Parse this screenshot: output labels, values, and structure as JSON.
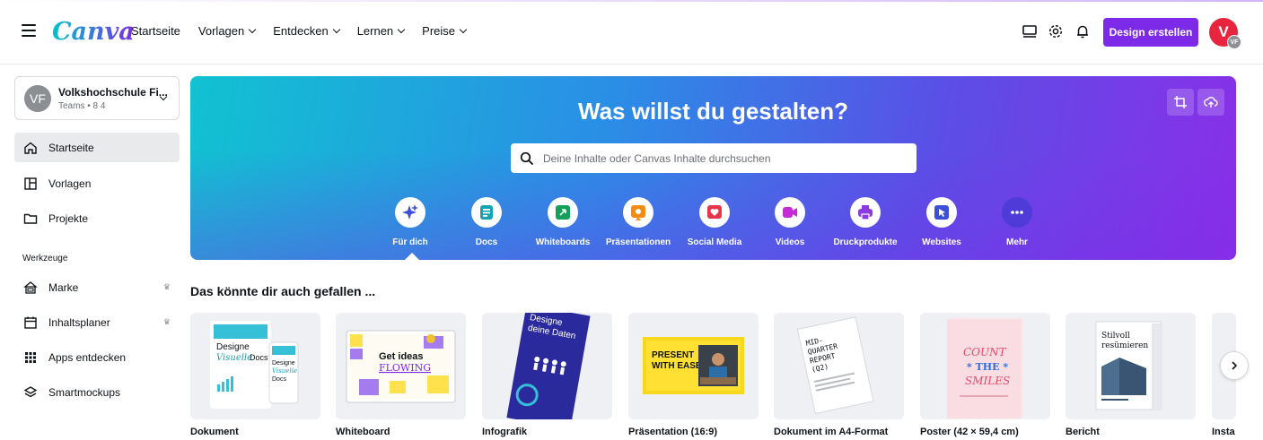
{
  "header": {
    "logo": "Canva",
    "nav": [
      {
        "label": "Startseite",
        "has_dropdown": false
      },
      {
        "label": "Vorlagen",
        "has_dropdown": true
      },
      {
        "label": "Entdecken",
        "has_dropdown": true
      },
      {
        "label": "Lernen",
        "has_dropdown": true
      },
      {
        "label": "Preise",
        "has_dropdown": true
      }
    ],
    "icons": [
      "desktop-icon",
      "gear-icon",
      "bell-icon"
    ],
    "design_button": "Design erstellen",
    "avatar_initial": "V",
    "avatar_badge": "VF",
    "accent_color": "#7d2ae8",
    "avatar_color": "#e8253f"
  },
  "sidebar": {
    "team": {
      "avatar": "VF",
      "name": "Volkshochschule Fi...",
      "sub": "Teams • 8 4"
    },
    "items": [
      {
        "label": "Startseite",
        "icon": "home-icon",
        "active": true
      },
      {
        "label": "Vorlagen",
        "icon": "template-icon",
        "active": false
      },
      {
        "label": "Projekte",
        "icon": "folder-icon",
        "active": false
      }
    ],
    "tools_heading": "Werkzeuge",
    "tools": [
      {
        "label": "Marke",
        "icon": "brand-icon",
        "crown": "♛"
      },
      {
        "label": "Inhaltsplaner",
        "icon": "calendar-icon",
        "crown": "♛"
      },
      {
        "label": "Apps entdecken",
        "icon": "apps-grid-icon",
        "crown": ""
      },
      {
        "label": "Smartmockups",
        "icon": "layers-icon",
        "crown": ""
      }
    ]
  },
  "hero": {
    "title": "Was willst du gestalten?",
    "search_placeholder": "Deine Inhalte oder Canvas Inhalte durchsuchen",
    "categories": [
      {
        "label": "Für dich",
        "icon": "sparkle-icon",
        "color": "#3b4fd8"
      },
      {
        "label": "Docs",
        "icon": "doc-icon",
        "color": "#13a3b5"
      },
      {
        "label": "Whiteboards",
        "icon": "whiteboard-icon",
        "color": "#12a05a"
      },
      {
        "label": "Präsentationen",
        "icon": "presentation-icon",
        "color": "#f28c13"
      },
      {
        "label": "Social Media",
        "icon": "heart-icon",
        "color": "#e8354a"
      },
      {
        "label": "Videos",
        "icon": "video-icon",
        "color": "#c42bd6"
      },
      {
        "label": "Druckprodukte",
        "icon": "print-icon",
        "color": "#8a3ae0"
      },
      {
        "label": "Websites",
        "icon": "cursor-icon",
        "color": "#3b4fd8"
      },
      {
        "label": "Mehr",
        "icon": "more-icon",
        "color": "#4f3bd8"
      }
    ]
  },
  "suggestions": {
    "title": "Das könnte dir auch gefallen ...",
    "cards": [
      {
        "label": "Dokument",
        "thumb_text": "Designe Visuelle Docs"
      },
      {
        "label": "Whiteboard",
        "thumb_text": "Get ideas FLOWING"
      },
      {
        "label": "Infografik",
        "thumb_text": "Designe deine Daten"
      },
      {
        "label": "Präsentation (16:9)",
        "thumb_text": "PRESENT WITH EASE"
      },
      {
        "label": "Dokument im A4-Format",
        "thumb_text": "MID-QUARTER REPORT (Q2)"
      },
      {
        "label": "Poster (42 × 59,4 cm)",
        "thumb_text": "COUNT THE SMILES"
      },
      {
        "label": "Bericht",
        "thumb_text": "Stilvoll resümieren"
      },
      {
        "label": "Insta",
        "thumb_text": ""
      }
    ]
  }
}
